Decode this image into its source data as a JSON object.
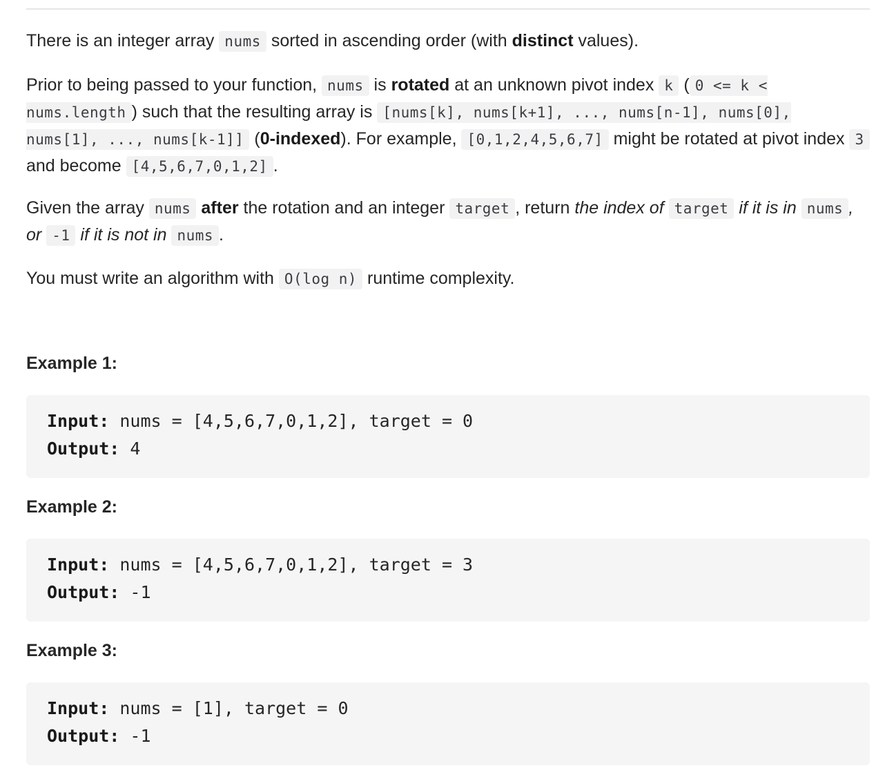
{
  "paragraph1": {
    "t1": "There is an integer array ",
    "c1": "nums",
    "t2": " sorted in ascending order (with ",
    "b1": "distinct",
    "t3": " values)."
  },
  "paragraph2": {
    "t1": "Prior to being passed to your function, ",
    "c1": "nums",
    "t2": " is ",
    "b1": "rotated",
    "t3": " at an unknown pivot index ",
    "c2": "k",
    "t4": " (",
    "c3": "0 <= k < nums.length",
    "t5": ") such that the resulting array is ",
    "c4": "[nums[k], nums[k+1], ..., nums[n-1], nums[0], nums[1], ..., nums[k-1]]",
    "t6": " (",
    "b2": "0-indexed",
    "t7": "). For example, ",
    "c5": "[0,1,2,4,5,6,7]",
    "t8": " might be rotated at pivot index ",
    "c6": "3",
    "t9": " and become ",
    "c7": "[4,5,6,7,0,1,2]",
    "t10": "."
  },
  "paragraph3": {
    "t1": "Given the array ",
    "c1": "nums",
    "t2": " ",
    "b1": "after",
    "t3": " the rotation and an integer ",
    "c2": "target",
    "t4": ", return ",
    "i1": "the index of ",
    "c3": "target",
    "i2": " if it is in ",
    "c4": "nums",
    "i3": ", or ",
    "c5": "-1",
    "i4": " if it is not in ",
    "c6": "nums",
    "t5": "."
  },
  "paragraph4": {
    "t1": "You must write an algorithm with ",
    "c1": "O(log n)",
    "t2": " runtime complexity."
  },
  "examples": [
    {
      "title": "Example 1:",
      "input_label": "Input:",
      "input_value": " nums = [4,5,6,7,0,1,2], target = 0",
      "output_label": "Output:",
      "output_value": " 4"
    },
    {
      "title": "Example 2:",
      "input_label": "Input:",
      "input_value": " nums = [4,5,6,7,0,1,2], target = 3",
      "output_label": "Output:",
      "output_value": " -1"
    },
    {
      "title": "Example 3:",
      "input_label": "Input:",
      "input_value": " nums = [1], target = 0",
      "output_label": "Output:",
      "output_value": " -1"
    }
  ]
}
